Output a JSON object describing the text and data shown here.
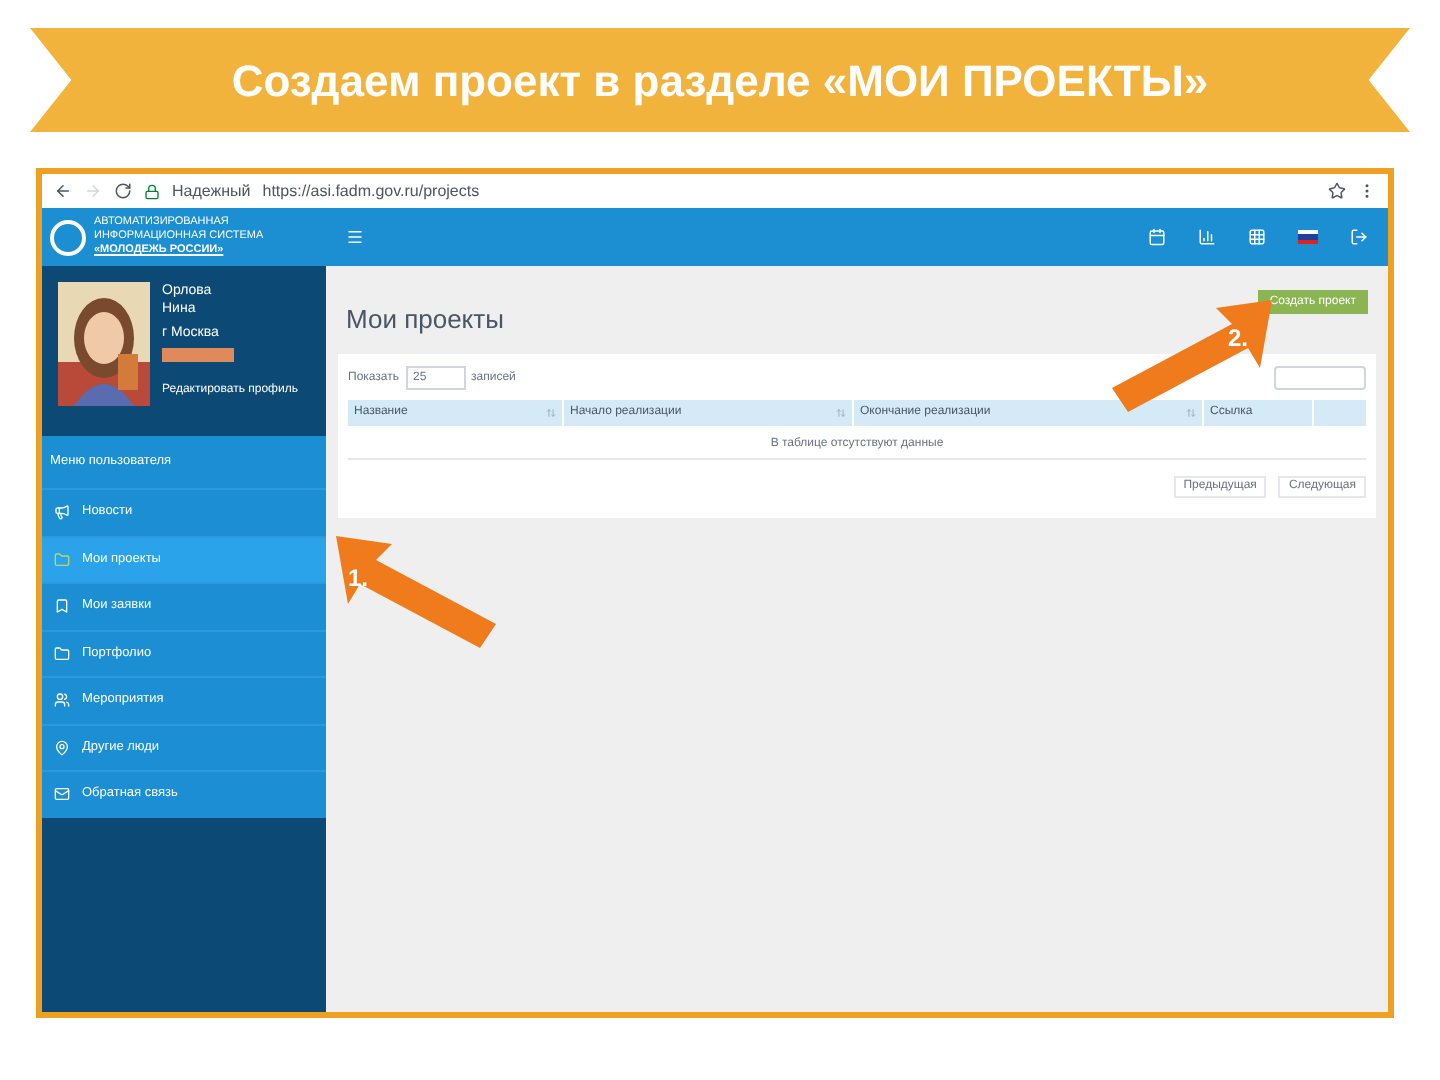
{
  "slide_title": "Создаем проект в разделе «МОИ ПРОЕКТЫ»",
  "browser": {
    "security": "Надежный",
    "url": "https://asi.fadm.gov.ru/projects"
  },
  "app": {
    "logo_lines": [
      "АВТОМАТИЗИРОВАННАЯ",
      "ИНФОРМАЦИОННАЯ СИСТЕМА",
      "«МОЛОДЕЖЬ РОССИИ»"
    ]
  },
  "profile": {
    "surname": "Орлова",
    "name": "Нина",
    "city": "г Москва",
    "edit_link": "Редактировать профиль"
  },
  "menu": {
    "heading": "Меню пользователя",
    "items": [
      {
        "label": "Новости",
        "selected": false
      },
      {
        "label": "Мои проекты",
        "selected": true
      },
      {
        "label": "Мои заявки",
        "selected": false
      },
      {
        "label": "Портфолио",
        "selected": false
      },
      {
        "label": "Мероприятия",
        "selected": false
      },
      {
        "label": "Другие люди",
        "selected": false
      },
      {
        "label": "Обратная связь",
        "selected": false
      }
    ]
  },
  "page": {
    "title": "Мои проекты",
    "create_button": "Создать проект",
    "show_prefix": "Показать",
    "page_size": "25",
    "show_suffix": "записей",
    "columns": [
      "Название",
      "Начало реализации",
      "Окончание реализации",
      "Ссылка"
    ],
    "empty_message": "В таблице отсутствуют данные",
    "pager": [
      "Предыдущая",
      "Следующая"
    ]
  },
  "callouts": [
    {
      "label": "1."
    },
    {
      "label": "2."
    }
  ]
}
